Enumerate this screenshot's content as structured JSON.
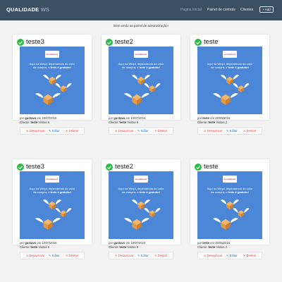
{
  "navbar": {
    "brand_bold": "QUALIDADE",
    "brand_light": "WS",
    "links": [
      "Página Inicial",
      "Painel de controle",
      "Clientes"
    ],
    "add_label": "+ Add"
  },
  "welcome": "Bem vindo ao painel de administração!",
  "promo": {
    "logo": "ecommerce",
    "line1": "Aqui na Wmpi, dependendo do valor",
    "line2": "da compra, o",
    "line2_bold": "frete é gratuito!"
  },
  "labels": {
    "por": "por",
    "em": "em",
    "cliente": "Cliente:",
    "desaprovar": "Desaprovar",
    "editar": "Editar",
    "deletar": "Deletar"
  },
  "cards": [
    {
      "title": "teste3",
      "author": "gustavo",
      "date": "10/07/2016",
      "client": "teste",
      "visitas": "Visitas 6"
    },
    {
      "title": "teste2",
      "author": "gustavo",
      "date": "10/07/2016",
      "client": "teste",
      "visitas": "Visitas 8"
    },
    {
      "title": "teste",
      "author": "teste",
      "date": "28/06/2016",
      "client": "teste",
      "visitas": "Visitas 2"
    },
    {
      "title": "teste3",
      "author": "gustavo",
      "date": "10/07/2016",
      "client": "teste",
      "visitas": "Visitas 6"
    },
    {
      "title": "teste2",
      "author": "gustavo",
      "date": "10/07/2016",
      "client": "teste",
      "visitas": "Visitas 8"
    },
    {
      "title": "teste",
      "author": "teste",
      "date": "28/06/2016",
      "client": "teste",
      "visitas": "Visitas 2"
    }
  ],
  "colors": {
    "navbar": "#3b4f63",
    "check": "#2dbb46",
    "promo_bg": "#4c86d6",
    "danger": "#d9534f",
    "primary": "#337ab7"
  }
}
